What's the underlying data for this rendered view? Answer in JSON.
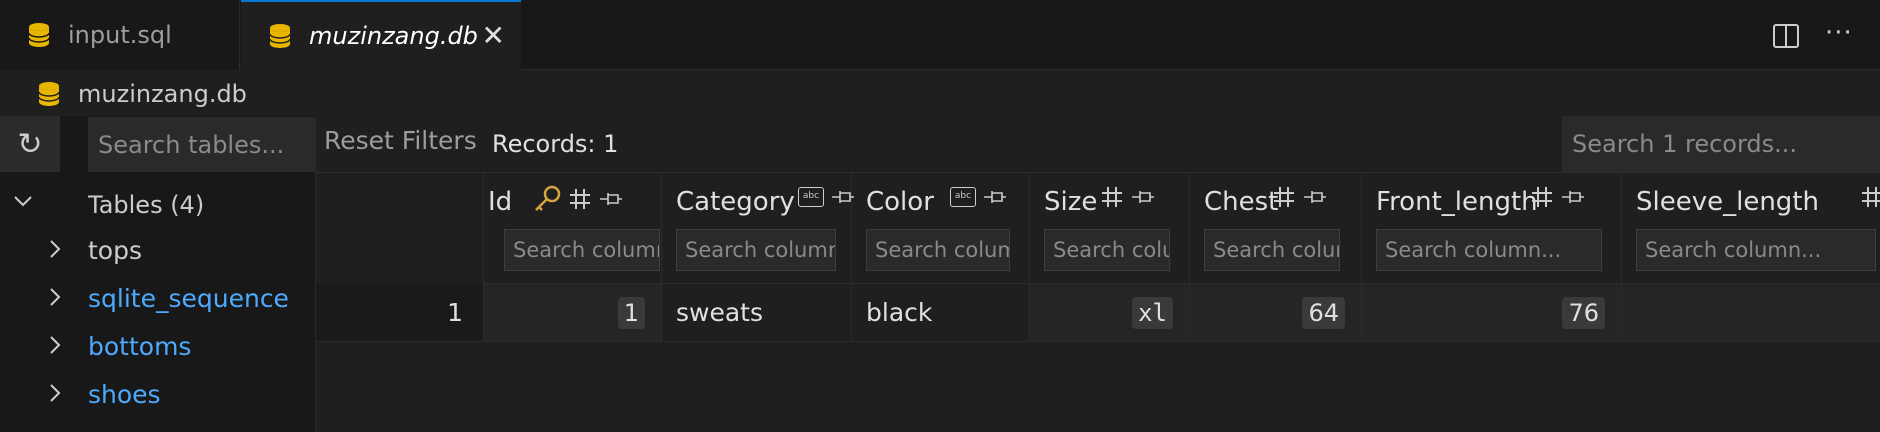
{
  "tabs": [
    {
      "label": "input.sql",
      "active": false
    },
    {
      "label": "muzinzang.db",
      "active": true
    }
  ],
  "breadcrumb": {
    "label": "muzinzang.db"
  },
  "sidebar": {
    "search_placeholder": "Search tables...",
    "tables_header": "Tables (4)",
    "items": [
      {
        "label": "tops",
        "color": "#cccccc"
      },
      {
        "label": "sqlite_sequence",
        "color": "#4daafc"
      },
      {
        "label": "bottoms",
        "color": "#4daafc"
      },
      {
        "label": "shoes",
        "color": "#4daafc"
      }
    ]
  },
  "toolbar": {
    "reset_label": "Reset Filters",
    "records_label": "Records: 1",
    "search_placeholder": "Search 1 records..."
  },
  "columns": [
    {
      "name": "Id",
      "type_icon": "hash-icon",
      "key": true,
      "placeholder": "Search column..."
    },
    {
      "name": "Category",
      "type_icon": "text-type-icon",
      "key": false,
      "placeholder": "Search column..."
    },
    {
      "name": "Color",
      "type_icon": "text-type-icon",
      "key": false,
      "placeholder": "Search column..."
    },
    {
      "name": "Size",
      "type_icon": "hash-icon",
      "key": false,
      "placeholder": "Search column..."
    },
    {
      "name": "Chest",
      "type_icon": "hash-icon",
      "key": false,
      "placeholder": "Search column..."
    },
    {
      "name": "Front_length",
      "type_icon": "hash-icon",
      "key": false,
      "placeholder": "Search column..."
    },
    {
      "name": "Sleeve_length",
      "type_icon": "hash-icon",
      "key": false,
      "placeholder": "Search column..."
    }
  ],
  "rows": [
    {
      "rownum": "1",
      "cells": [
        "1",
        "sweats",
        "black",
        "xl",
        "64",
        "76",
        ""
      ]
    }
  ],
  "colors": {
    "accent": "#0078d4",
    "link": "#4daafc",
    "db_icon": "#e8b600",
    "key_icon": "#d7a540"
  }
}
